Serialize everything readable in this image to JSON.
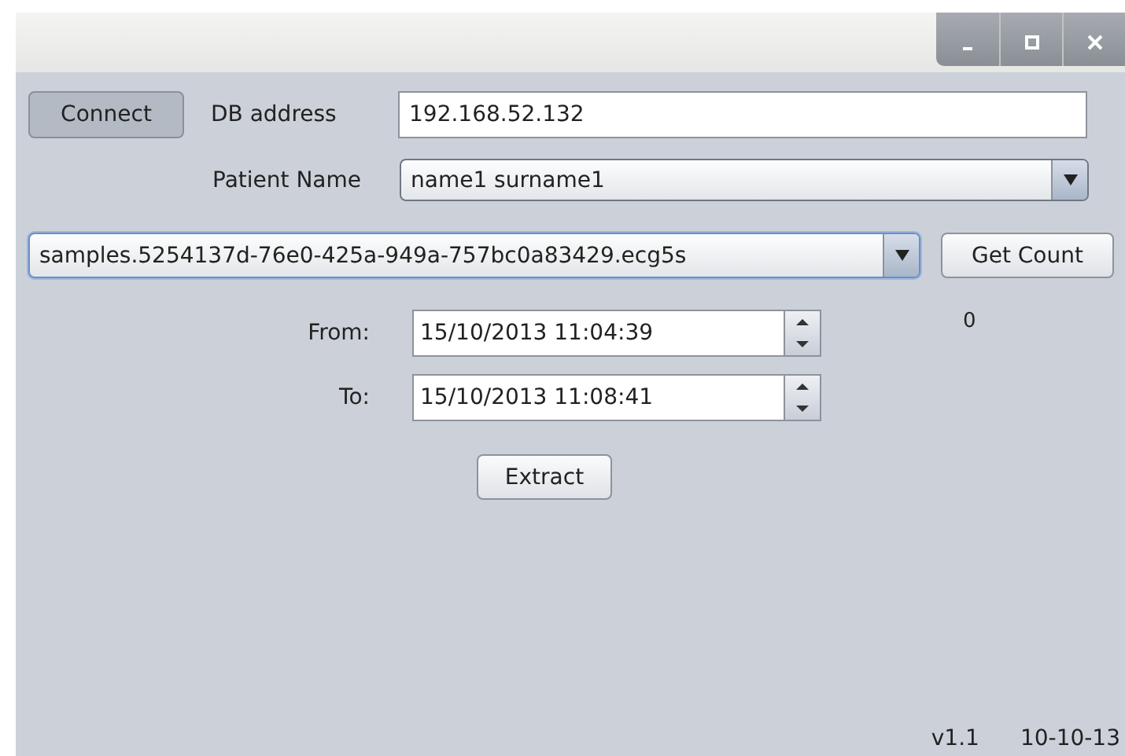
{
  "window": {
    "controls": [
      {
        "kind": "minimize"
      },
      {
        "kind": "maximize"
      },
      {
        "kind": "close"
      }
    ]
  },
  "connect_button": {
    "label": "Connect",
    "pressed": true
  },
  "db_address": {
    "label": "DB address",
    "value": "192.168.52.132"
  },
  "patient_name": {
    "label": "Patient Name",
    "value": "name1 surname1"
  },
  "collection": {
    "value": "samples.5254137d-76e0-425a-949a-757bc0a83429.ecg5s",
    "focused": true
  },
  "get_count_button": {
    "label": "Get Count"
  },
  "count": "0",
  "from": {
    "label": "From:",
    "value": "15/10/2013 11:04:39"
  },
  "to": {
    "label": "To:",
    "value": "15/10/2013 11:08:41"
  },
  "extract_button": {
    "label": "Extract"
  },
  "footer": {
    "version": "v1.1",
    "date": "10-10-13"
  }
}
